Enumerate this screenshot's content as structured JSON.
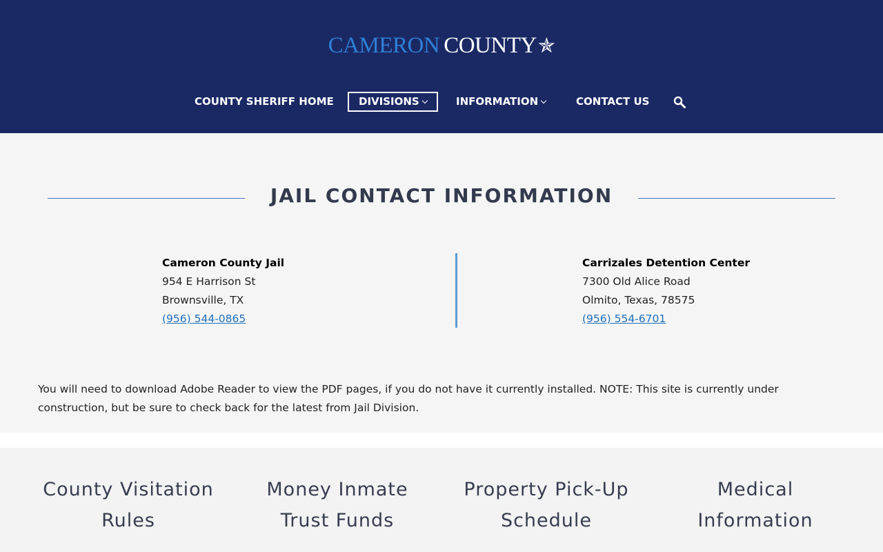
{
  "header": {
    "logo_word1": "CAMERON",
    "logo_word2": "COUNTY",
    "logo_icon": "star-icon",
    "bg_color": "#1a2964",
    "accent_color": "#2f7fd6"
  },
  "nav": {
    "items": [
      {
        "label": "COUNTY SHERIFF HOME"
      },
      {
        "label": "DIVISIONS"
      },
      {
        "label": "INFORMATION"
      },
      {
        "label": "CONTACT US"
      }
    ],
    "search_icon": "search-icon"
  },
  "section": {
    "title": "JAIL CONTACT INFORMATION"
  },
  "contacts": [
    {
      "name": "Cameron County Jail",
      "address1": "954 E Harrison St",
      "address2": "Brownsville, TX",
      "phone": "(956) 544-0865"
    },
    {
      "name": "Carrizales Detention Center",
      "address1": "7300 Old Alice Road",
      "address2": "Olmito, Texas, 78575",
      "phone": "(956) 554-6701"
    }
  ],
  "notice": "You will need to download Adobe Reader to view the PDF pages, if you do not have it currently installed. NOTE: This site is currently under construction, but be sure to check back for the latest from Jail Division.",
  "tiles": [
    {
      "line1": "County Visitation",
      "line2": "Rules"
    },
    {
      "line1": "Money Inmate",
      "line2": "Trust Funds"
    },
    {
      "line1": "Property Pick-Up",
      "line2": "Schedule"
    },
    {
      "line1": "Medical",
      "line2": "Information"
    }
  ]
}
